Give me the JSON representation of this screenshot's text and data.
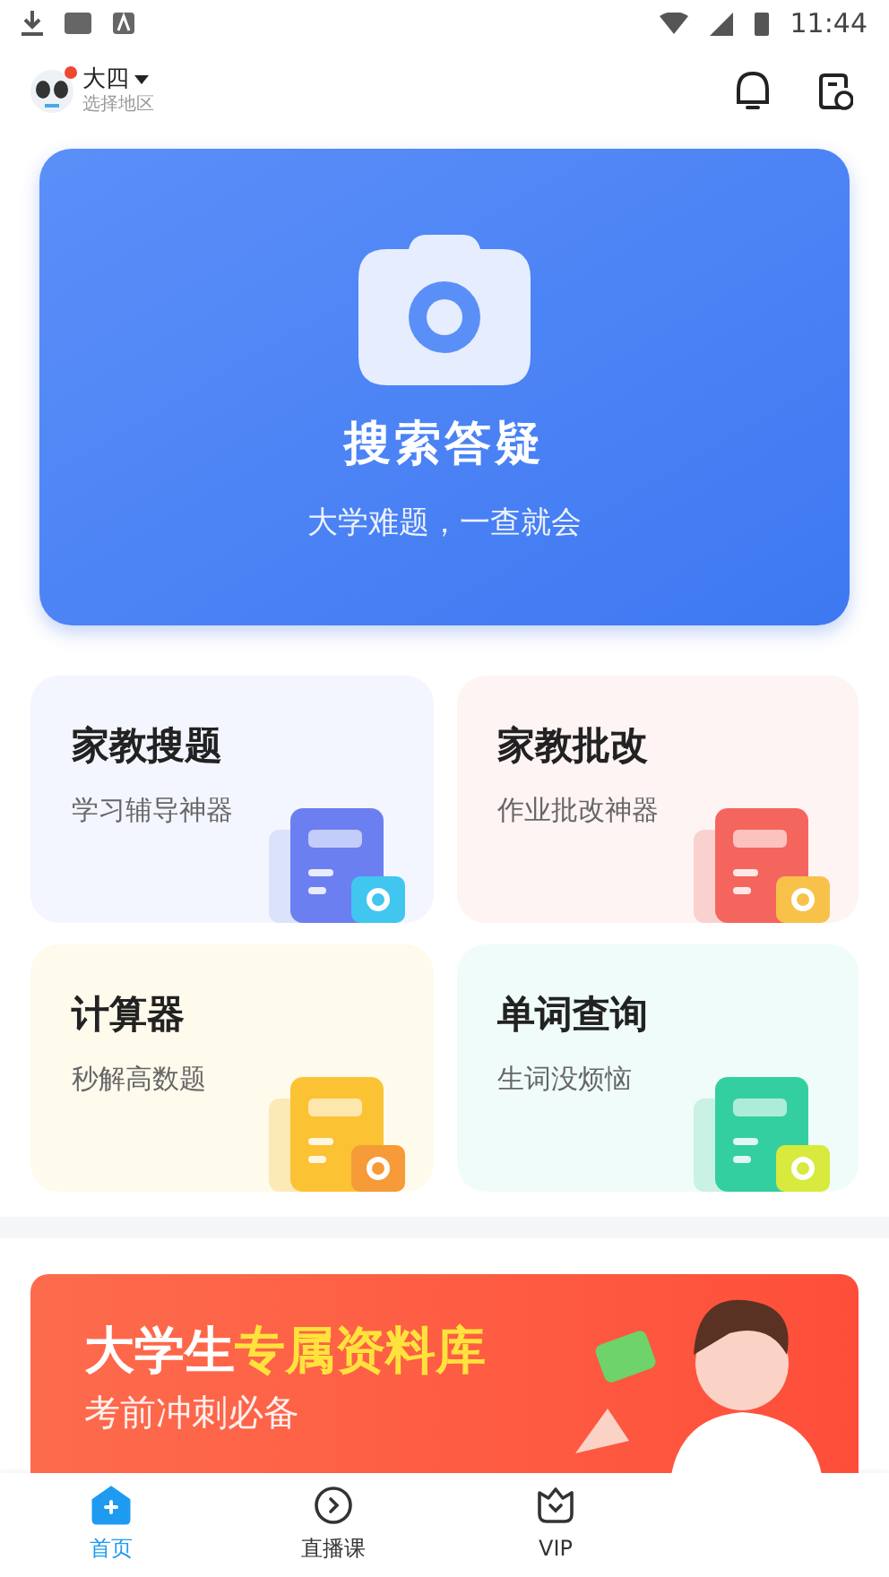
{
  "status_bar": {
    "time": "11:44"
  },
  "header": {
    "grade": "大四",
    "region": "选择地区",
    "has_notification": true
  },
  "search_banner": {
    "title": "搜索答疑",
    "subtitle": "大学难题，一查就会"
  },
  "tools": [
    {
      "kind": "search",
      "title": "家教搜题",
      "subtitle": "学习辅导神器"
    },
    {
      "kind": "grade",
      "title": "家教批改",
      "subtitle": "作业批改神器"
    },
    {
      "kind": "calculator",
      "title": "计算器",
      "subtitle": "秒解高数题"
    },
    {
      "kind": "words",
      "title": "单词查询",
      "subtitle": "生词没烦恼"
    }
  ],
  "promo": {
    "title_plain": "大学生",
    "title_highlight": "专属资料库",
    "subtitle": "考前冲刺必备"
  },
  "tab_bar": [
    {
      "kind": "home",
      "label": "首页",
      "selected": true
    },
    {
      "kind": "live",
      "label": "直播课",
      "selected": false
    },
    {
      "kind": "vip",
      "label": "VIP",
      "selected": false
    }
  ]
}
